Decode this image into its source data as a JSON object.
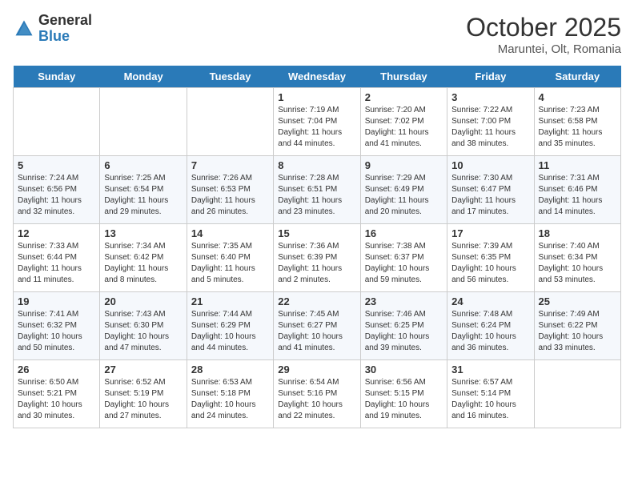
{
  "header": {
    "logo_general": "General",
    "logo_blue": "Blue",
    "month_title": "October 2025",
    "subtitle": "Maruntei, Olt, Romania"
  },
  "weekdays": [
    "Sunday",
    "Monday",
    "Tuesday",
    "Wednesday",
    "Thursday",
    "Friday",
    "Saturday"
  ],
  "weeks": [
    [
      null,
      null,
      null,
      {
        "day": 1,
        "sunrise": "7:19 AM",
        "sunset": "7:04 PM",
        "daylight": "11 hours and 44 minutes."
      },
      {
        "day": 2,
        "sunrise": "7:20 AM",
        "sunset": "7:02 PM",
        "daylight": "11 hours and 41 minutes."
      },
      {
        "day": 3,
        "sunrise": "7:22 AM",
        "sunset": "7:00 PM",
        "daylight": "11 hours and 38 minutes."
      },
      {
        "day": 4,
        "sunrise": "7:23 AM",
        "sunset": "6:58 PM",
        "daylight": "11 hours and 35 minutes."
      }
    ],
    [
      {
        "day": 5,
        "sunrise": "7:24 AM",
        "sunset": "6:56 PM",
        "daylight": "11 hours and 32 minutes."
      },
      {
        "day": 6,
        "sunrise": "7:25 AM",
        "sunset": "6:54 PM",
        "daylight": "11 hours and 29 minutes."
      },
      {
        "day": 7,
        "sunrise": "7:26 AM",
        "sunset": "6:53 PM",
        "daylight": "11 hours and 26 minutes."
      },
      {
        "day": 8,
        "sunrise": "7:28 AM",
        "sunset": "6:51 PM",
        "daylight": "11 hours and 23 minutes."
      },
      {
        "day": 9,
        "sunrise": "7:29 AM",
        "sunset": "6:49 PM",
        "daylight": "11 hours and 20 minutes."
      },
      {
        "day": 10,
        "sunrise": "7:30 AM",
        "sunset": "6:47 PM",
        "daylight": "11 hours and 17 minutes."
      },
      {
        "day": 11,
        "sunrise": "7:31 AM",
        "sunset": "6:46 PM",
        "daylight": "11 hours and 14 minutes."
      }
    ],
    [
      {
        "day": 12,
        "sunrise": "7:33 AM",
        "sunset": "6:44 PM",
        "daylight": "11 hours and 11 minutes."
      },
      {
        "day": 13,
        "sunrise": "7:34 AM",
        "sunset": "6:42 PM",
        "daylight": "11 hours and 8 minutes."
      },
      {
        "day": 14,
        "sunrise": "7:35 AM",
        "sunset": "6:40 PM",
        "daylight": "11 hours and 5 minutes."
      },
      {
        "day": 15,
        "sunrise": "7:36 AM",
        "sunset": "6:39 PM",
        "daylight": "11 hours and 2 minutes."
      },
      {
        "day": 16,
        "sunrise": "7:38 AM",
        "sunset": "6:37 PM",
        "daylight": "10 hours and 59 minutes."
      },
      {
        "day": 17,
        "sunrise": "7:39 AM",
        "sunset": "6:35 PM",
        "daylight": "10 hours and 56 minutes."
      },
      {
        "day": 18,
        "sunrise": "7:40 AM",
        "sunset": "6:34 PM",
        "daylight": "10 hours and 53 minutes."
      }
    ],
    [
      {
        "day": 19,
        "sunrise": "7:41 AM",
        "sunset": "6:32 PM",
        "daylight": "10 hours and 50 minutes."
      },
      {
        "day": 20,
        "sunrise": "7:43 AM",
        "sunset": "6:30 PM",
        "daylight": "10 hours and 47 minutes."
      },
      {
        "day": 21,
        "sunrise": "7:44 AM",
        "sunset": "6:29 PM",
        "daylight": "10 hours and 44 minutes."
      },
      {
        "day": 22,
        "sunrise": "7:45 AM",
        "sunset": "6:27 PM",
        "daylight": "10 hours and 41 minutes."
      },
      {
        "day": 23,
        "sunrise": "7:46 AM",
        "sunset": "6:25 PM",
        "daylight": "10 hours and 39 minutes."
      },
      {
        "day": 24,
        "sunrise": "7:48 AM",
        "sunset": "6:24 PM",
        "daylight": "10 hours and 36 minutes."
      },
      {
        "day": 25,
        "sunrise": "7:49 AM",
        "sunset": "6:22 PM",
        "daylight": "10 hours and 33 minutes."
      }
    ],
    [
      {
        "day": 26,
        "sunrise": "6:50 AM",
        "sunset": "5:21 PM",
        "daylight": "10 hours and 30 minutes."
      },
      {
        "day": 27,
        "sunrise": "6:52 AM",
        "sunset": "5:19 PM",
        "daylight": "10 hours and 27 minutes."
      },
      {
        "day": 28,
        "sunrise": "6:53 AM",
        "sunset": "5:18 PM",
        "daylight": "10 hours and 24 minutes."
      },
      {
        "day": 29,
        "sunrise": "6:54 AM",
        "sunset": "5:16 PM",
        "daylight": "10 hours and 22 minutes."
      },
      {
        "day": 30,
        "sunrise": "6:56 AM",
        "sunset": "5:15 PM",
        "daylight": "10 hours and 19 minutes."
      },
      {
        "day": 31,
        "sunrise": "6:57 AM",
        "sunset": "5:14 PM",
        "daylight": "10 hours and 16 minutes."
      },
      null
    ]
  ]
}
